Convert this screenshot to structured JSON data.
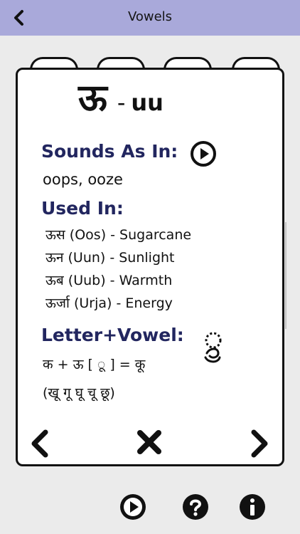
{
  "header": {
    "title": "Vowels"
  },
  "card": {
    "letter": "ऊ",
    "dash": "-",
    "transliteration": "uu",
    "sounds_label": "Sounds As In:",
    "sounds_value": "oops, ooze",
    "used_label": "Used In:",
    "used_items": [
      "ऊस (Oos) - Sugarcane",
      "ऊन (Uun) - Sunlight",
      "ऊब (Uub) - Warmth",
      "ऊर्जा (Urja) - Energy"
    ],
    "letter_vowel_label": "Letter+Vowel:",
    "formula": "क + ऊ [ ◌ू ] = कू",
    "examples": "(खू गू घू चू छू)"
  },
  "icons": {
    "back": "chevron-left-icon",
    "play": "play-circle-icon",
    "prev": "chevron-left-icon",
    "close": "close-icon",
    "next": "chevron-right-icon",
    "help": "help-circle-icon",
    "info": "info-circle-icon"
  },
  "colors": {
    "header_bg": "#a9a9da",
    "section_label": "#22265f",
    "page_bg": "#ebebeb"
  }
}
